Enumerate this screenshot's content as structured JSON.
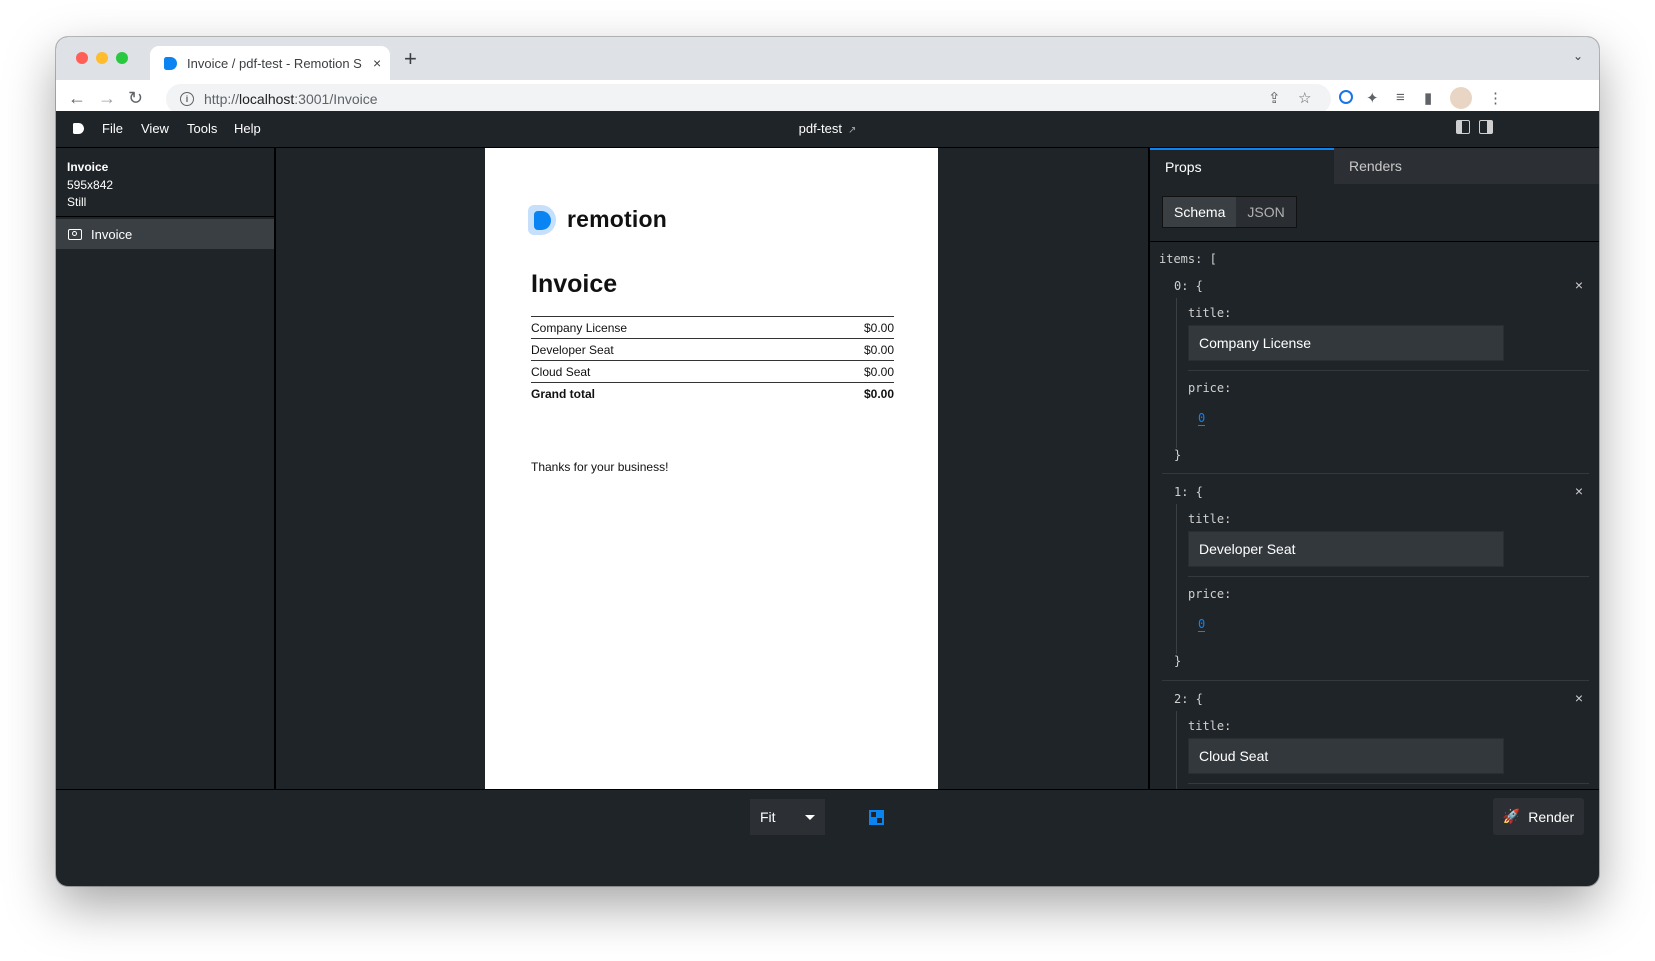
{
  "browser": {
    "tab_title": "Invoice / pdf-test - Remotion S",
    "tab_close": "×",
    "new_tab": "+",
    "url_scheme": "http://",
    "url_host": "localhost",
    "url_rest": ":3001/Invoice"
  },
  "menubar": {
    "items": [
      "File",
      "View",
      "Tools",
      "Help"
    ],
    "project_title": "pdf-test"
  },
  "sidebar": {
    "composition_name": "Invoice",
    "composition_dims": "595x842",
    "composition_kind": "Still",
    "items": [
      {
        "label": "Invoice"
      }
    ]
  },
  "document": {
    "logo_text": "remotion",
    "heading": "Invoice",
    "rows": [
      {
        "title": "Company License",
        "price": "$0.00"
      },
      {
        "title": "Developer Seat",
        "price": "$0.00"
      },
      {
        "title": "Cloud Seat",
        "price": "$0.00"
      }
    ],
    "total_label": "Grand total",
    "total_value": "$0.00",
    "thanks": "Thanks for your business!"
  },
  "props_panel": {
    "tabs": [
      "Props",
      "Renders"
    ],
    "modes": [
      "Schema",
      "JSON"
    ],
    "items_label": "items: [",
    "title_key": "title:",
    "price_key": "price:",
    "close_glyph": "×",
    "entries": [
      {
        "index_label": "0: {",
        "title": "Company License",
        "price": "0",
        "close": "}"
      },
      {
        "index_label": "1: {",
        "title": "Developer Seat",
        "price": "0",
        "close": "}"
      },
      {
        "index_label": "2: {",
        "title": "Cloud Seat"
      }
    ]
  },
  "bottombar": {
    "zoom": "Fit",
    "render_label": "Render"
  },
  "colors": {
    "accent": "#0b84f3",
    "app_bg": "#1f2428"
  }
}
